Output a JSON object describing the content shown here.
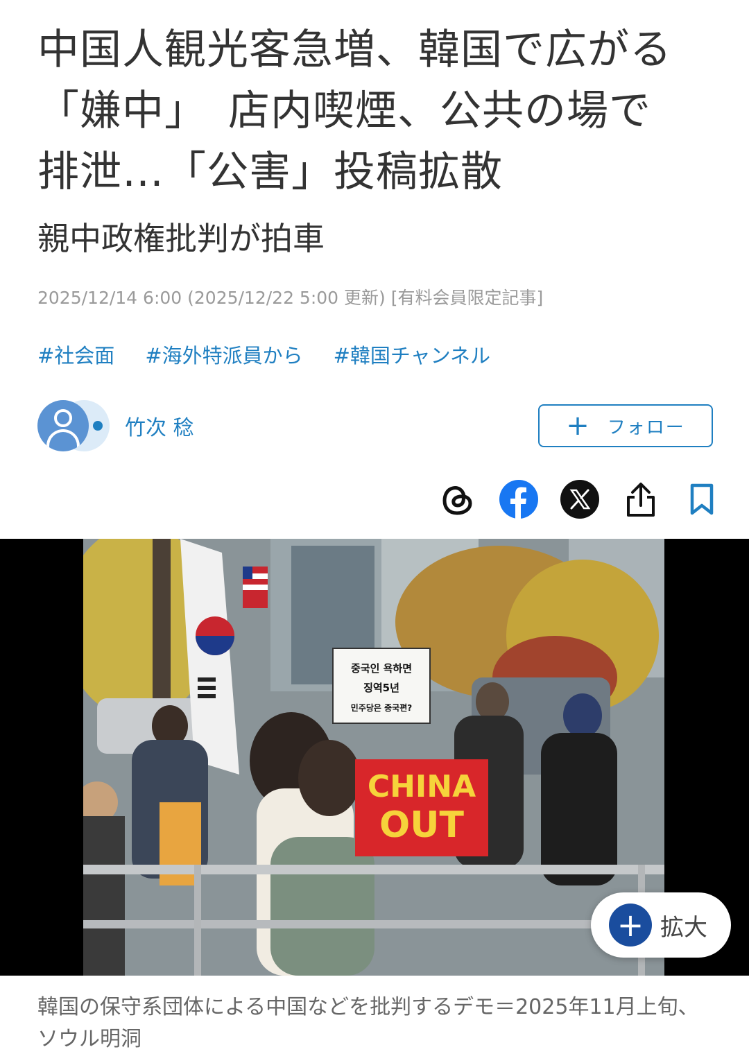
{
  "article": {
    "headline_lines": [
      "中国人観光客急増、韓国で広がる",
      "「嫌中」　店内喫煙、公共の場で",
      "排泄…「公害」投稿拡散"
    ],
    "subheadline": "親中政権批判が拍車",
    "dateline": "2025/12/14 6:00 (2025/12/22 5:00 更新) [有料会員限定記事]",
    "tags": [
      "#社会面",
      "#海外特派員から",
      "#韓国チャンネル"
    ]
  },
  "author": {
    "name": "竹次 稔",
    "follow_label": "フォロー",
    "follow_icon": "plus-icon"
  },
  "share": {
    "icons": [
      "threads-icon",
      "facebook-icon",
      "x-icon",
      "share-icon",
      "bookmark-icon"
    ]
  },
  "photo": {
    "sign_korean_lines": [
      "중국인 욕하면",
      "징역5년",
      "민주당은 중국편?"
    ],
    "sign_red_lines": [
      "CHINA",
      "OUT"
    ],
    "zoom_label": "拡大",
    "zoom_icon": "plus-icon",
    "caption": "韓国の保守系団体による中国などを批判するデモ＝2025年11月上旬、ソウル明洞"
  },
  "colors": {
    "link": "#1f7fc1",
    "text": "#333333",
    "muted": "#9a9a9a",
    "zoom_button": "#1a4d9e",
    "facebook": "#1877f2",
    "sign_red": "#d8262a",
    "sign_yellow": "#f6d33b"
  }
}
